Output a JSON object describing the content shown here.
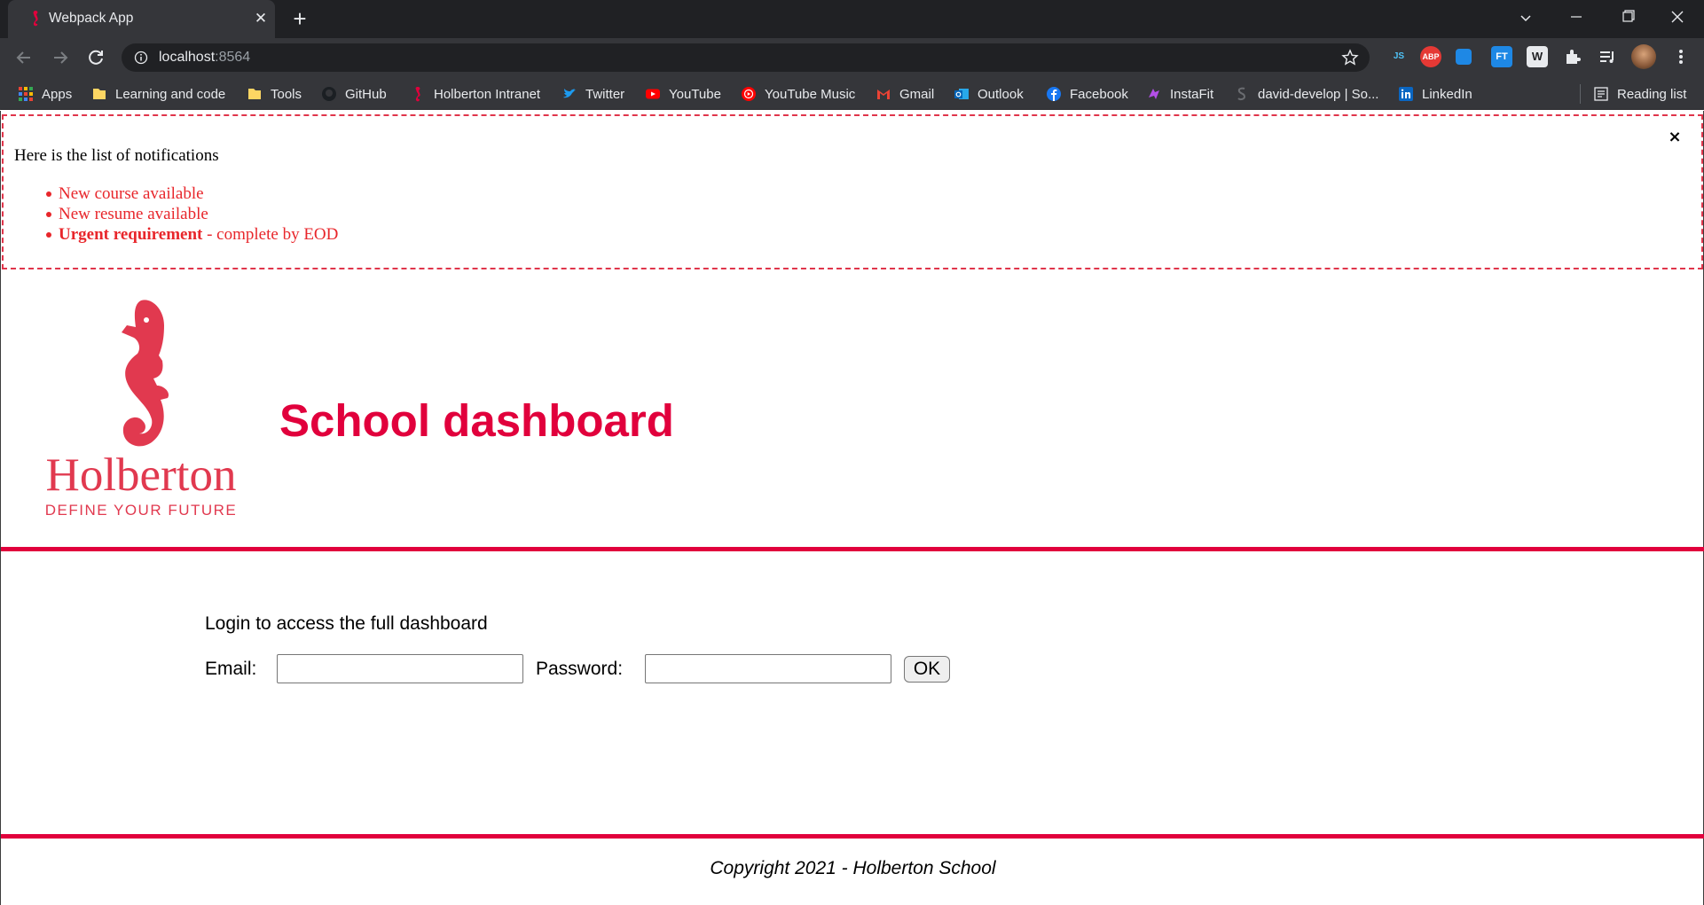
{
  "browser": {
    "tab_title": "Webpack App",
    "url_host": "localhost",
    "url_port": ":8564",
    "bookmarks": [
      {
        "label": "Apps",
        "icon": "apps-grid-icon"
      },
      {
        "label": "Learning and code",
        "icon": "folder-icon"
      },
      {
        "label": "Tools",
        "icon": "folder-icon"
      },
      {
        "label": "GitHub",
        "icon": "github-icon"
      },
      {
        "label": "Holberton Intranet",
        "icon": "seahorse-icon"
      },
      {
        "label": "Twitter",
        "icon": "twitter-icon"
      },
      {
        "label": "YouTube",
        "icon": "youtube-icon"
      },
      {
        "label": "YouTube Music",
        "icon": "youtube-music-icon"
      },
      {
        "label": "Gmail",
        "icon": "gmail-icon"
      },
      {
        "label": "Outlook",
        "icon": "outlook-icon"
      },
      {
        "label": "Facebook",
        "icon": "facebook-icon"
      },
      {
        "label": "InstaFit",
        "icon": "instafit-icon"
      },
      {
        "label": "david-develop | So...",
        "icon": "stackoverflow-icon"
      },
      {
        "label": "LinkedIn",
        "icon": "linkedin-icon"
      }
    ],
    "reading_list": "Reading list",
    "extensions": [
      "JS",
      "ABP",
      "FT",
      "W"
    ]
  },
  "notifications": {
    "title": "Here is the list of notifications",
    "items": [
      {
        "text": "New course available"
      },
      {
        "text": "New resume available"
      },
      {
        "bold": "Urgent requirement",
        "text": " - complete by EOD"
      }
    ],
    "close_symbol": "×"
  },
  "header": {
    "logo_brand": "Holberton",
    "logo_tagline": "DEFINE YOUR FUTURE",
    "title": "School dashboard"
  },
  "login": {
    "prompt": "Login to access the full dashboard",
    "email_label": "Email:",
    "email_value": "",
    "password_label": "Password:",
    "password_value": "",
    "ok_label": "OK"
  },
  "footer": {
    "text": "Copyright 2021 - Holberton School"
  },
  "colors": {
    "brand_red": "#e1003c",
    "notification_red": "#e8262b",
    "chrome_dark": "#202124",
    "chrome_mid": "#35363a"
  }
}
